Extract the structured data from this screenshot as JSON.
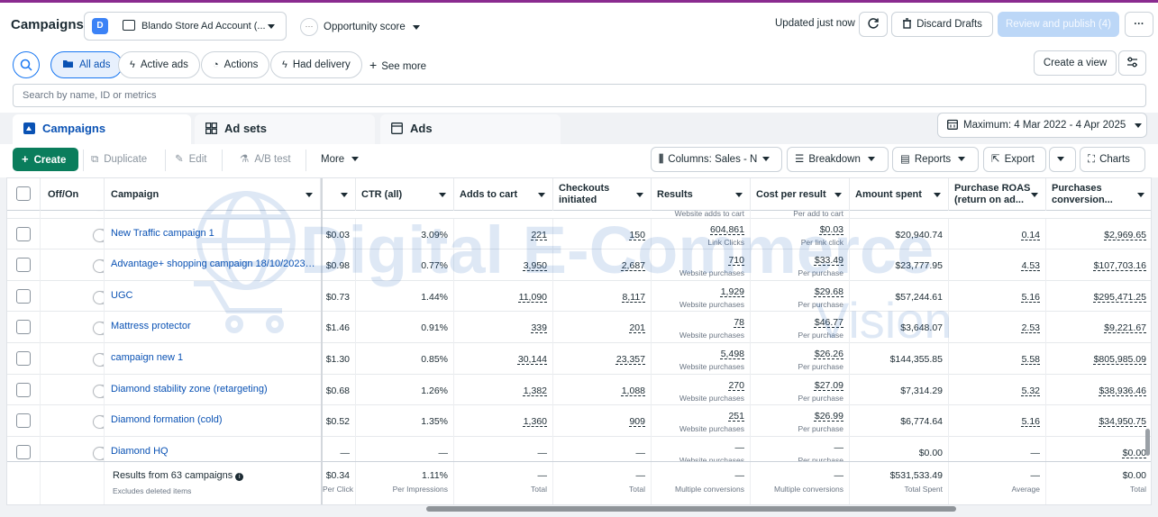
{
  "header": {
    "title": "Campaigns",
    "account_badge": "D",
    "account_name": "Blando Store Ad Account (...",
    "opportunity": "Opportunity score",
    "opportunity_dots": "···",
    "updated": "Updated just now",
    "discard": "Discard Drafts",
    "publish": "Review and publish (4)",
    "more": "···"
  },
  "filters": {
    "pills": [
      "All ads",
      "Active ads",
      "Actions",
      "Had delivery"
    ],
    "see_more": "See more",
    "create_view": "Create a view",
    "search_placeholder": "Search by name, ID or metrics"
  },
  "tabs": [
    "Campaigns",
    "Ad sets",
    "Ads"
  ],
  "date_range": "Maximum: 4 Mar 2022 - 4 Apr 2025",
  "toolbar": {
    "create": "Create",
    "duplicate": "Duplicate",
    "edit": "Edit",
    "ab_test": "A/B test",
    "more": "More",
    "columns": "Columns: Sales - N",
    "breakdown": "Breakdown",
    "reports": "Reports",
    "export": "Export",
    "charts": "Charts"
  },
  "table": {
    "headers": {
      "offon": "Off/On",
      "campaign": "Campaign",
      "ctr": "CTR (all)",
      "atc": "Adds to cart",
      "checkouts": "Checkouts initiated",
      "results": "Results",
      "cpr": "Cost per result",
      "spent": "Amount spent",
      "roas": "Purchase ROAS (return on ad...",
      "pcv": "Purchases conversion..."
    },
    "partial_top": {
      "results_sub": "Website adds to cart",
      "cpr_sub": "Per add to cart"
    },
    "rows": [
      {
        "name": "New Traffic campaign 1",
        "cpc": "$0.03",
        "ctr": "3.09%",
        "atc": "221",
        "co": "150",
        "res": "604,861",
        "res_sub": "Link Clicks",
        "cpr": "$0.03",
        "cpr_sub": "Per link click",
        "spent": "$20,940.74",
        "roas": "0.14",
        "pcv": "$2,969.65"
      },
      {
        "name": "Advantage+ shopping campaign 18/10/2023 C...",
        "cpc": "$0.98",
        "ctr": "0.77%",
        "atc": "3,950",
        "co": "2,687",
        "res": "710",
        "res_sub": "Website purchases",
        "cpr": "$33.49",
        "cpr_sub": "Per purchase",
        "spent": "$23,777.95",
        "roas": "4.53",
        "pcv": "$107,703.16"
      },
      {
        "name": "UGC",
        "cpc": "$0.73",
        "ctr": "1.44%",
        "atc": "11,090",
        "co": "8,117",
        "res": "1,929",
        "res_sub": "Website purchases",
        "cpr": "$29.68",
        "cpr_sub": "Per purchase",
        "spent": "$57,244.61",
        "roas": "5.16",
        "pcv": "$295,471.25"
      },
      {
        "name": "Mattress protector",
        "cpc": "$1.46",
        "ctr": "0.91%",
        "atc": "339",
        "co": "201",
        "res": "78",
        "res_sub": "Website purchases",
        "cpr": "$46.77",
        "cpr_sub": "Per purchase",
        "spent": "$3,648.07",
        "roas": "2.53",
        "pcv": "$9,221.67"
      },
      {
        "name": "campaign new 1",
        "cpc": "$1.30",
        "ctr": "0.85%",
        "atc": "30,144",
        "co": "23,357",
        "res": "5,498",
        "res_sub": "Website purchases",
        "cpr": "$26.26",
        "cpr_sub": "Per purchase",
        "spent": "$144,355.85",
        "roas": "5.58",
        "pcv": "$805,985.09"
      },
      {
        "name": "Diamond stability zone (retargeting)",
        "cpc": "$0.68",
        "ctr": "1.26%",
        "atc": "1,382",
        "co": "1,088",
        "res": "270",
        "res_sub": "Website purchases",
        "cpr": "$27.09",
        "cpr_sub": "Per purchase",
        "spent": "$7,314.29",
        "roas": "5.32",
        "pcv": "$38,936.46"
      },
      {
        "name": "Diamond formation (cold)",
        "cpc": "$0.52",
        "ctr": "1.35%",
        "atc": "1,360",
        "co": "909",
        "res": "251",
        "res_sub": "Website purchases",
        "cpr": "$26.99",
        "cpr_sub": "Per purchase",
        "spent": "$6,774.64",
        "roas": "5.16",
        "pcv": "$34,950.75"
      },
      {
        "name": "Diamond HQ",
        "cpc": "—",
        "ctr": "—",
        "atc": "—",
        "co": "—",
        "res": "—",
        "res_sub": "Website purchases",
        "cpr": "—",
        "cpr_sub": "Per purchase",
        "spent": "$0.00",
        "roas": "—",
        "pcv": "$0.00"
      }
    ],
    "footer": {
      "label": "Results from 63 campaigns",
      "sub": "Excludes deleted items",
      "cpc": "$0.34",
      "cpc_sub": "Per Click",
      "ctr": "1.11%",
      "ctr_sub": "Per Impressions",
      "atc": "—",
      "atc_sub": "Total",
      "co": "—",
      "co_sub": "Total",
      "res": "—",
      "res_sub": "Multiple conversions",
      "cpr": "—",
      "cpr_sub": "Multiple conversions",
      "spent": "$531,533.49",
      "spent_sub": "Total Spent",
      "roas": "—",
      "roas_sub": "Average",
      "pcv": "$0.00",
      "pcv_sub": "Total"
    }
  },
  "watermark": {
    "line1": "Digital E-Commerce",
    "line2": "Vision"
  },
  "colors": {
    "accent": "#1877f2",
    "create": "#0a7d5c",
    "link": "#0a52b4",
    "topbar": "#8a2b8f"
  },
  "icons": [
    "search-icon",
    "lightning-icon",
    "actions-icon",
    "plus-icon",
    "settings-icon",
    "refresh-icon",
    "trash-icon",
    "calendar-icon",
    "columns-icon",
    "breakdown-icon",
    "reports-icon",
    "export-icon",
    "charts-icon"
  ]
}
